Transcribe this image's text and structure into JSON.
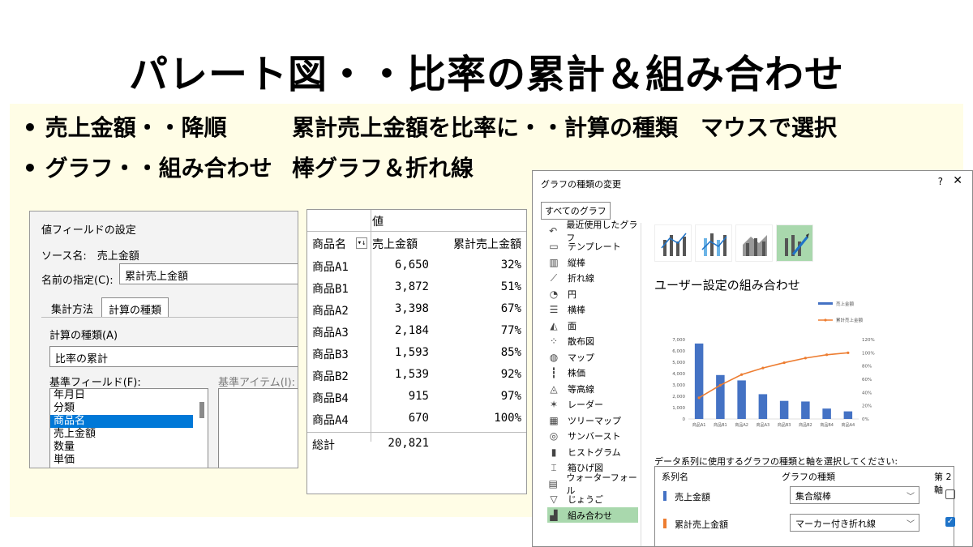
{
  "slide": {
    "title": "パレート図・・比率の累計＆組み合わせ",
    "bullet1": "• 売上金額・・降順",
    "bullet1_desc": "累計売上金額を比率に・・計算の種類　マウスで選択",
    "bullet2": "• グラフ・・組み合わせ",
    "bullet2_desc": "棒グラフ＆折れ線",
    "background_color": "#fffde6"
  },
  "value_field_dialog": {
    "title": "値フィールドの設定",
    "source_label": "ソース名:　売上金額",
    "name_label": "名前の指定(C):",
    "name_value": "累計売上金額",
    "tab_summarize": "集計方法",
    "tab_calc": "計算の種類",
    "calc_label": "計算の種類(A)",
    "calc_value": "比率の累計",
    "base_field_label": "基準フィールド(F):",
    "base_item_label": "基準アイテム(I):",
    "base_fields": [
      "年月日",
      "分類",
      "商品名",
      "売上金額",
      "数量",
      "単価"
    ],
    "selected_field": "商品名"
  },
  "pivot": {
    "value_header": "値",
    "col_product": "商品名",
    "col_sales": "売上金額",
    "col_cum": "累計売上金額",
    "rows": [
      {
        "name": "商品A1",
        "sales": "6,650",
        "cum": "32%"
      },
      {
        "name": "商品B1",
        "sales": "3,872",
        "cum": "51%"
      },
      {
        "name": "商品A2",
        "sales": "3,398",
        "cum": "67%"
      },
      {
        "name": "商品A3",
        "sales": "2,184",
        "cum": "77%"
      },
      {
        "name": "商品B3",
        "sales": "1,593",
        "cum": "85%"
      },
      {
        "name": "商品B2",
        "sales": "1,539",
        "cum": "92%"
      },
      {
        "name": "商品B4",
        "sales": "915",
        "cum": "97%"
      },
      {
        "name": "商品A4",
        "sales": "670",
        "cum": "100%"
      }
    ],
    "total_label": "総計",
    "total_value": "20,821"
  },
  "chart_type_dialog": {
    "title": "グラフの種類の変更",
    "help": "?",
    "close": "✕",
    "all_charts_tab": "すべてのグラフ",
    "types": [
      {
        "label": "最近使用したグラフ",
        "icon": "recent-icon"
      },
      {
        "label": "テンプレート",
        "icon": "template-icon"
      },
      {
        "label": "縦棒",
        "icon": "column-icon"
      },
      {
        "label": "折れ線",
        "icon": "line-icon"
      },
      {
        "label": "円",
        "icon": "pie-icon"
      },
      {
        "label": "横棒",
        "icon": "bar-icon"
      },
      {
        "label": "面",
        "icon": "area-icon"
      },
      {
        "label": "散布図",
        "icon": "scatter-icon"
      },
      {
        "label": "マップ",
        "icon": "map-icon"
      },
      {
        "label": "株価",
        "icon": "stock-icon"
      },
      {
        "label": "等高線",
        "icon": "surface-icon"
      },
      {
        "label": "レーダー",
        "icon": "radar-icon"
      },
      {
        "label": "ツリーマップ",
        "icon": "treemap-icon"
      },
      {
        "label": "サンバースト",
        "icon": "sunburst-icon"
      },
      {
        "label": "ヒストグラム",
        "icon": "histogram-icon"
      },
      {
        "label": "箱ひげ図",
        "icon": "boxwhisker-icon"
      },
      {
        "label": "ウォーターフォール",
        "icon": "waterfall-icon"
      },
      {
        "label": "じょうご",
        "icon": "funnel-icon"
      },
      {
        "label": "組み合わせ",
        "icon": "combo-icon"
      }
    ],
    "selected_type": "組み合わせ",
    "heading": "ユーザー設定の組み合わせ",
    "series_prompt": "データ系列に使用するグラフの種類と軸を選択してください:",
    "col_series": "系列名",
    "col_type": "グラフの種類",
    "col_axis": "第 2 軸",
    "series": [
      {
        "name": "売上金額",
        "type": "集合縦棒",
        "secondary": false,
        "color": "#4472c4"
      },
      {
        "name": "累計売上金額",
        "type": "マーカー付き折れ線",
        "secondary": true,
        "color": "#ed7d31"
      }
    ],
    "selected_color": "#a9d8ad"
  },
  "chart_data": {
    "type": "bar",
    "categories": [
      "商品A1",
      "商品B1",
      "商品A2",
      "商品A3",
      "商品B3",
      "商品B2",
      "商品B4",
      "商品A4"
    ],
    "series": [
      {
        "name": "売上金額",
        "type": "bar",
        "axis": "primary",
        "color": "#4472c4",
        "values": [
          6650,
          3872,
          3398,
          2184,
          1593,
          1539,
          915,
          670
        ]
      },
      {
        "name": "累計売上金額",
        "type": "line",
        "axis": "secondary",
        "color": "#ed7d31",
        "values": [
          32,
          51,
          67,
          77,
          85,
          92,
          97,
          100
        ]
      }
    ],
    "ylim": [
      0,
      7000
    ],
    "y_ticks": [
      "0",
      "1,000",
      "2,000",
      "3,000",
      "4,000",
      "5,000",
      "6,000",
      "7,000"
    ],
    "y2lim": [
      0,
      120
    ],
    "y2_ticks": [
      "0%",
      "20%",
      "40%",
      "60%",
      "80%",
      "100%",
      "120%"
    ],
    "legend": "top-right"
  }
}
